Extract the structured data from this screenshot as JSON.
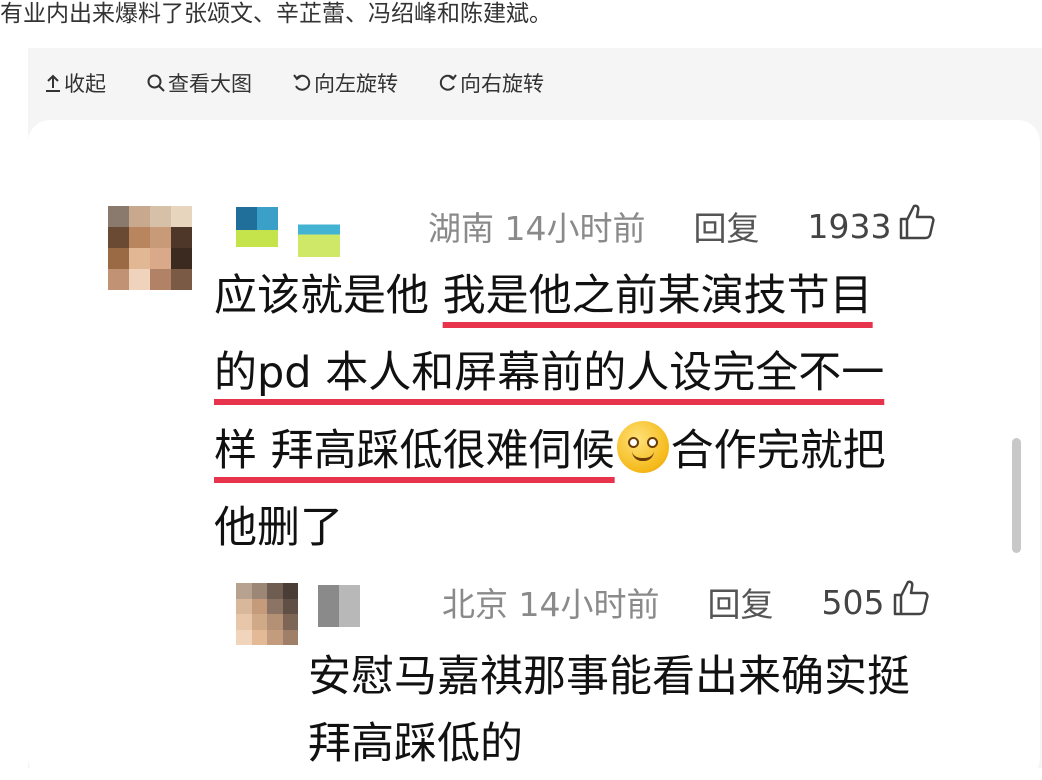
{
  "article": {
    "text": "有业内出来爆料了张颂文、辛芷蕾、冯绍峰和陈建斌。"
  },
  "toolbar": {
    "collapse_label": "收起",
    "collapse_icon": "arrow-up-icon",
    "view_large_label": "查看大图",
    "view_large_icon": "magnifier-icon",
    "rotate_left_label": "向左旋转",
    "rotate_left_icon": "rotate-left-icon",
    "rotate_right_label": "向右旋转",
    "rotate_right_icon": "rotate-right-icon"
  },
  "comments": [
    {
      "location": "湖南",
      "time": "14小时前",
      "reply_label": "回复",
      "likes": "1933",
      "text_plain_start": "应该就是他 ",
      "text_highlight_1": "我是他之前某演技节目",
      "text_highlight_2": "的pd 本人和屏幕前的人设完全不一",
      "text_highlight_3": "样 拜高踩低很难伺候",
      "text_after_emoji": "合作完就把",
      "text_end": "他删了",
      "emoji": "smiley-emoji"
    },
    {
      "location": "北京",
      "time": "14小时前",
      "reply_label": "回复",
      "likes": "505",
      "text_line_1": "安慰马嘉祺那事能看出来确实挺",
      "text_line_2": "拜高踩低的"
    }
  ],
  "colors": {
    "highlight_underline": "#e8334c",
    "meta_gray": "#8a8a8a",
    "card_bg": "#ffffff",
    "viewer_bg": "#f5f5f6"
  }
}
